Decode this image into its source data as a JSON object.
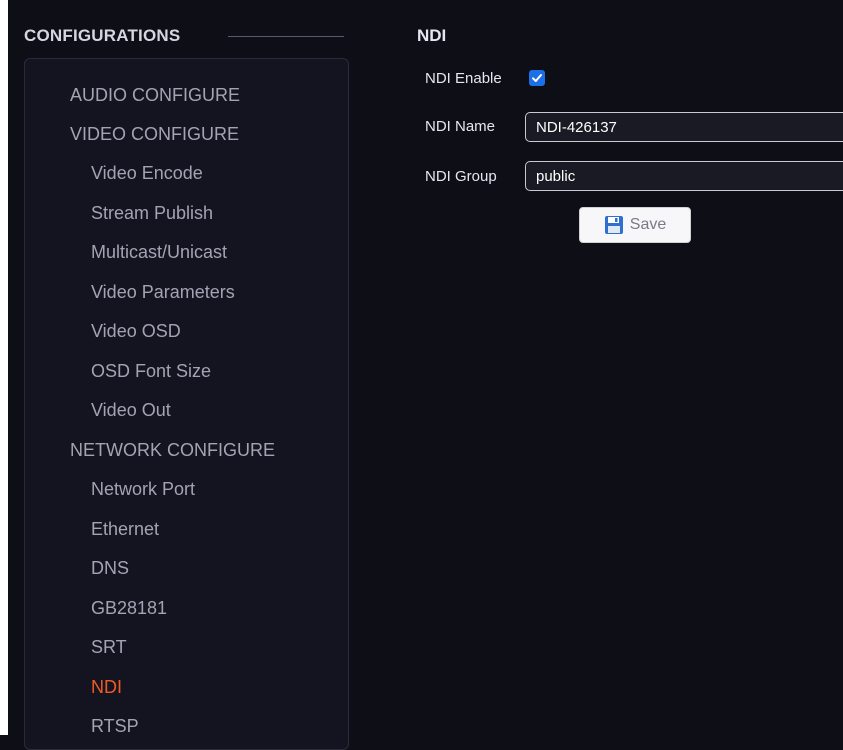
{
  "sidebar": {
    "header": "CONFIGURATIONS",
    "items": [
      {
        "label": "AUDIO CONFIGURE",
        "type": "category"
      },
      {
        "label": "VIDEO CONFIGURE",
        "type": "category"
      },
      {
        "label": "Video Encode",
        "type": "sub"
      },
      {
        "label": "Stream Publish",
        "type": "sub"
      },
      {
        "label": "Multicast/Unicast",
        "type": "sub"
      },
      {
        "label": "Video Parameters",
        "type": "sub"
      },
      {
        "label": "Video OSD",
        "type": "sub"
      },
      {
        "label": "OSD Font Size",
        "type": "sub"
      },
      {
        "label": "Video Out",
        "type": "sub"
      },
      {
        "label": "NETWORK CONFIGURE",
        "type": "category"
      },
      {
        "label": "Network Port",
        "type": "sub"
      },
      {
        "label": "Ethernet",
        "type": "sub"
      },
      {
        "label": "DNS",
        "type": "sub"
      },
      {
        "label": "GB28181",
        "type": "sub"
      },
      {
        "label": "SRT",
        "type": "sub"
      },
      {
        "label": "NDI",
        "type": "sub",
        "active": true
      },
      {
        "label": "RTSP",
        "type": "sub"
      }
    ]
  },
  "main": {
    "title": "NDI",
    "enable_label": "NDI Enable",
    "enable_checked": true,
    "name_label": "NDI Name",
    "name_value": "NDI-426137",
    "group_label": "NDI Group",
    "group_value": "public",
    "save_label": "Save"
  },
  "colors": {
    "background": "#0e0e16",
    "active_item": "#f25a23",
    "checkbox": "#1c6fe6"
  }
}
